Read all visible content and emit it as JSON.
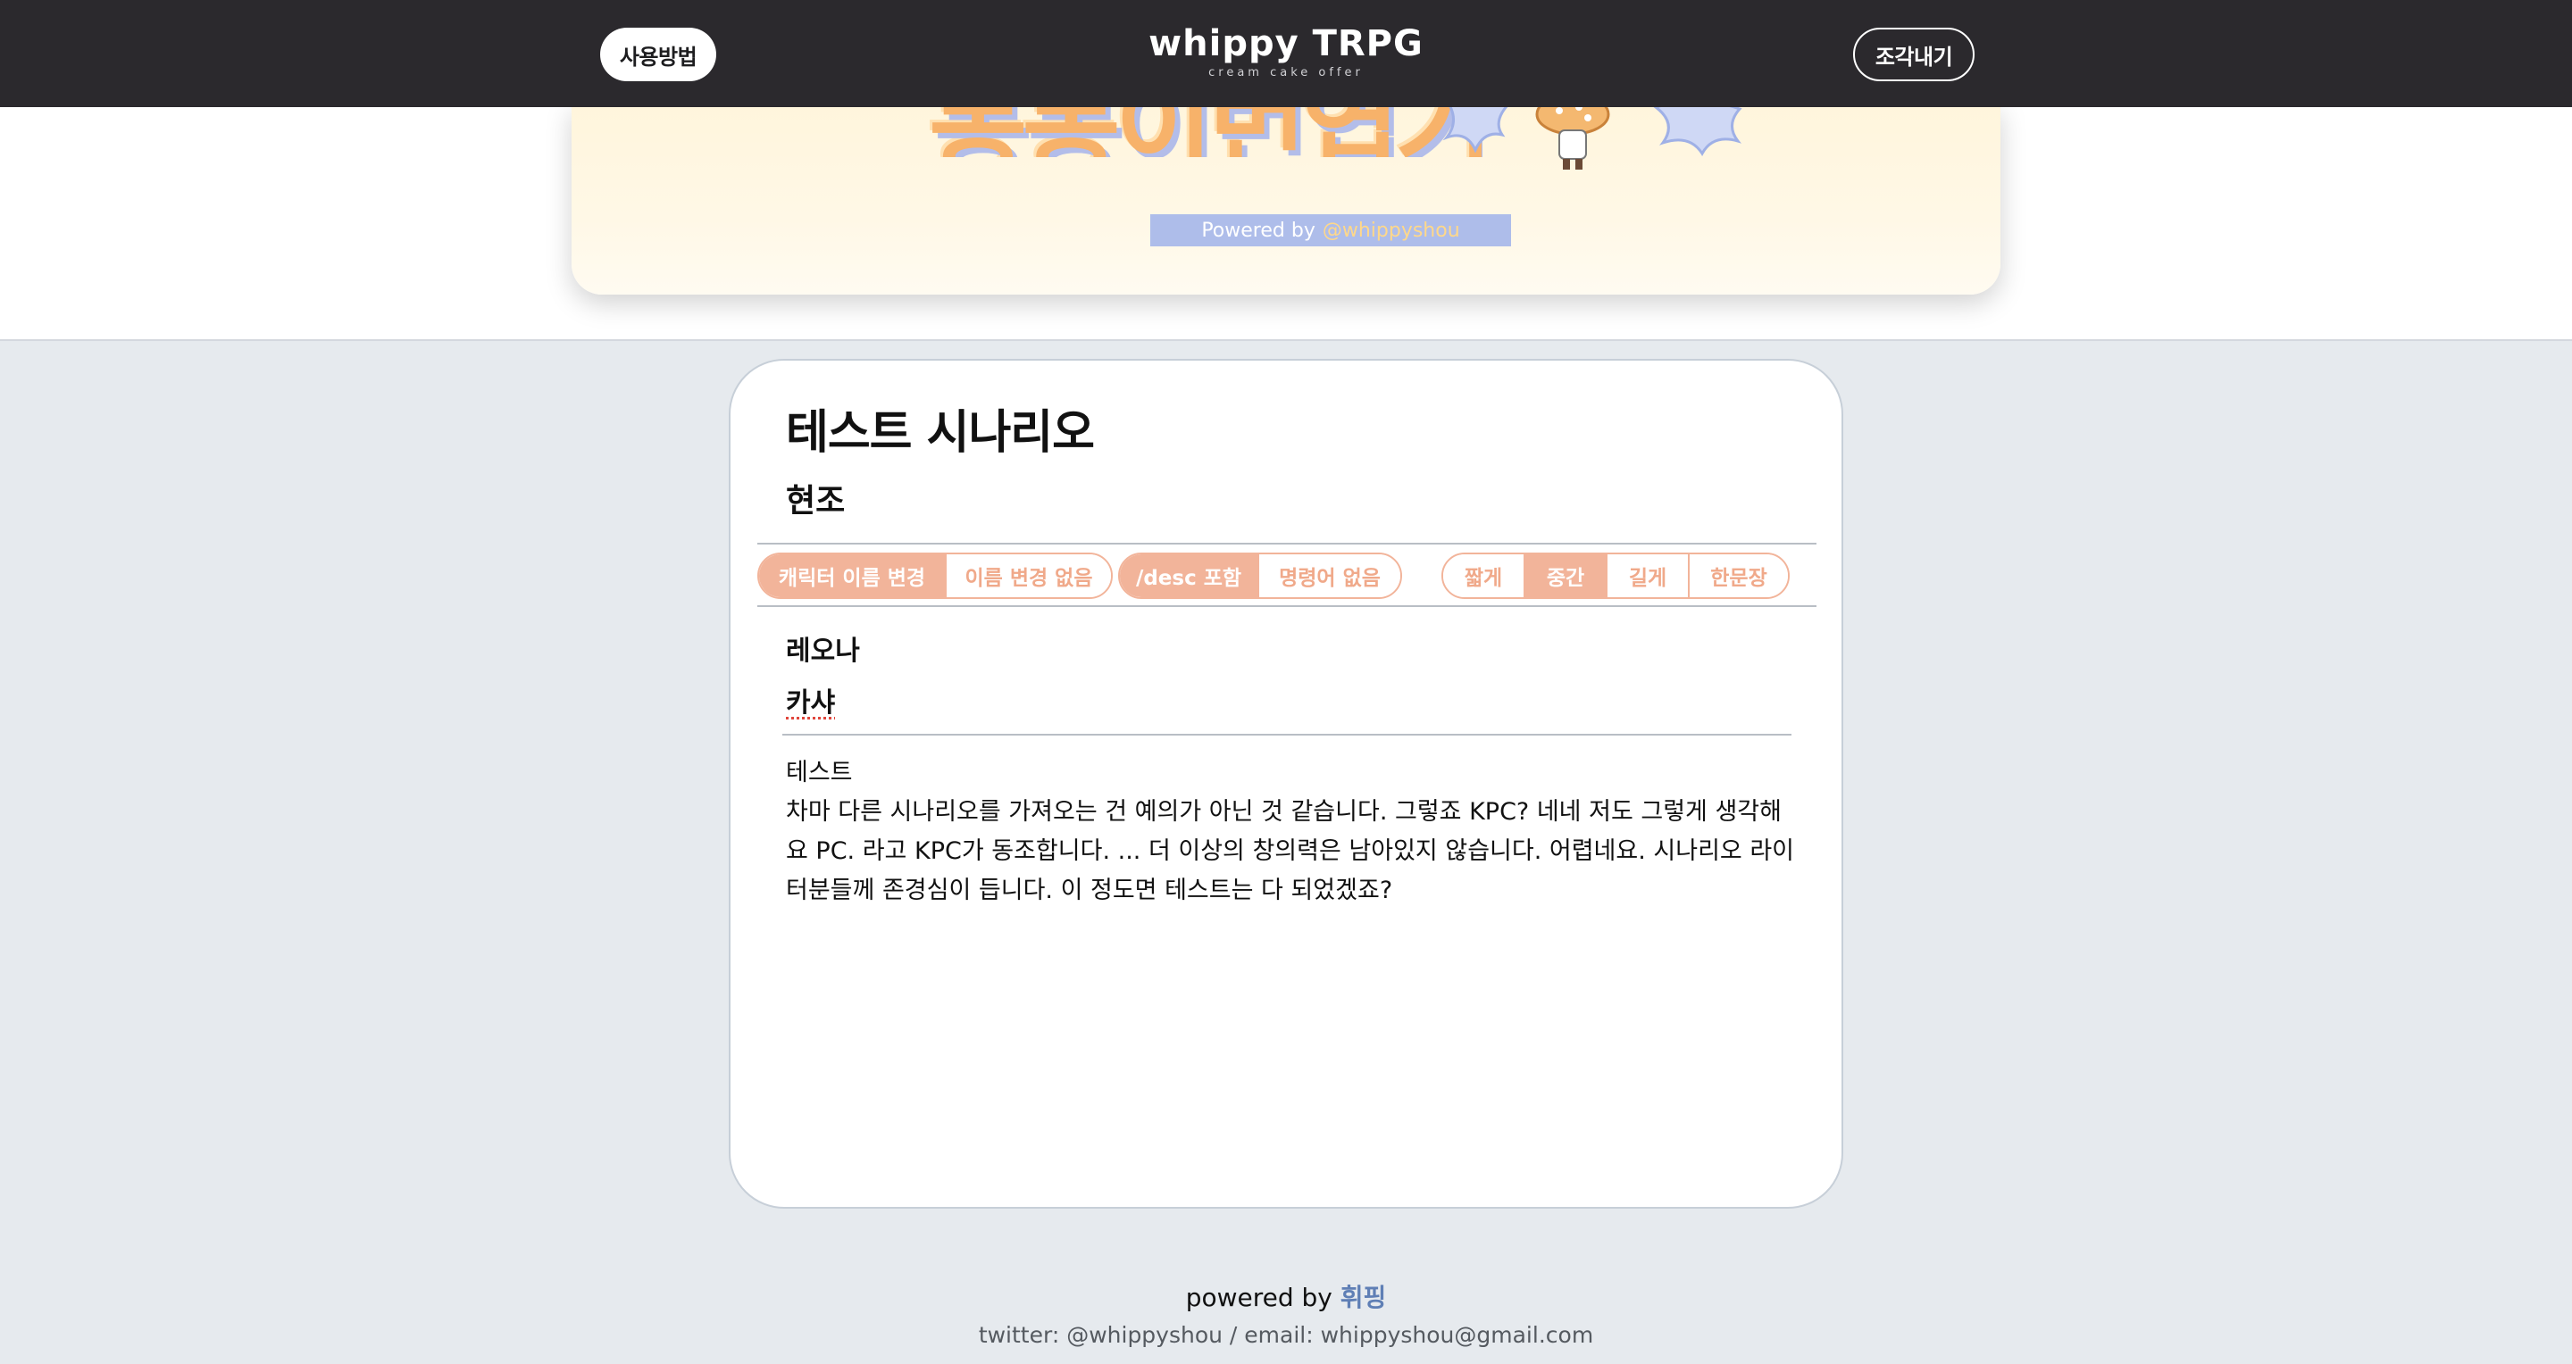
{
  "header": {
    "help_label": "사용방법",
    "logo_title": "whippy TRPG",
    "logo_subtitle": "cream cake offer",
    "export_label": "조각내기"
  },
  "banner": {
    "title_art": "몽몽이번엽기",
    "powered_prefix": "Powered by",
    "powered_handle": "@whippyshou"
  },
  "scenario": {
    "title": "테스트 시나리오",
    "author": "현조"
  },
  "options": {
    "name_group": [
      "캐릭터 이름 변경",
      "이름 변경 없음"
    ],
    "desc_group": [
      "/desc 포함",
      "명령어 없음"
    ],
    "length_group": [
      "짧게",
      "중간",
      "길게",
      "한문장"
    ]
  },
  "characters": [
    "레오나",
    "카샤"
  ],
  "log": {
    "lines": [
      "테스트",
      "차마 다른 시나리오를 가져오는 건 예의가 아닌 것 같습니다. 그렇죠 KPC? 네네 저도 그렇게 생각해요 PC. 라고 KPC가 동조합니다. ... 더 이상의 창의력은 남아있지 않습니다. 어렵네요. 시나리오 라이터분들께 존경심이 듭니다. 이 정도면 테스트는 다 되었겠죠?"
    ]
  },
  "footer": {
    "powered_prefix": "powered by",
    "brand": "휘핑",
    "contact": "twitter: @whippyshou / email: whippyshou@gmail.com"
  },
  "colors": {
    "topbar": "#2b292d",
    "accent": "#f2b49a",
    "page_bg": "#e6eaee",
    "banner_strip": "#aebdea"
  }
}
